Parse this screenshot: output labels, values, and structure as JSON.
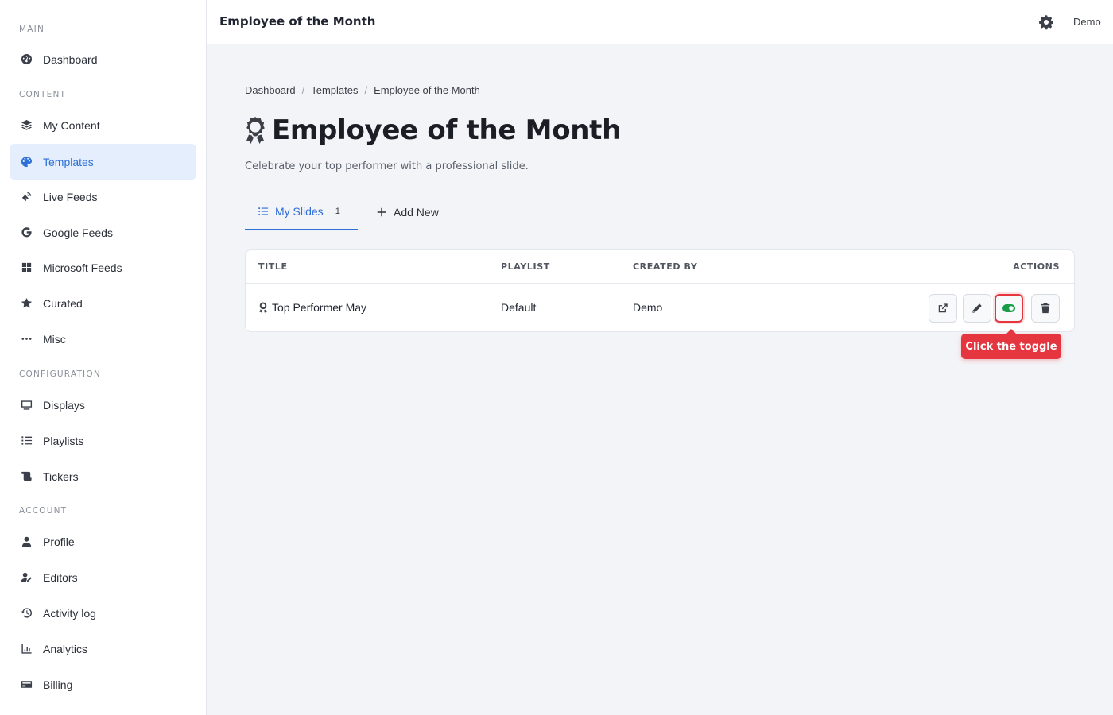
{
  "sidebar": {
    "sections": [
      {
        "label": "MAIN"
      },
      {
        "label": "CONTENT"
      },
      {
        "label": "CONFIGURATION"
      },
      {
        "label": "ACCOUNT"
      }
    ],
    "items": [
      {
        "label": "Dashboard",
        "icon": "gauge-icon"
      },
      {
        "label": "My Content",
        "icon": "layers-icon"
      },
      {
        "label": "Templates",
        "icon": "palette-icon"
      },
      {
        "label": "Live Feeds",
        "icon": "satellite-icon"
      },
      {
        "label": "Google Feeds",
        "icon": "google-icon"
      },
      {
        "label": "Microsoft Feeds",
        "icon": "windows-icon"
      },
      {
        "label": "Curated",
        "icon": "star-icon"
      },
      {
        "label": "Misc",
        "icon": "ellipsis-icon"
      },
      {
        "label": "Displays",
        "icon": "monitor-icon"
      },
      {
        "label": "Playlists",
        "icon": "list-icon"
      },
      {
        "label": "Tickers",
        "icon": "scroll-icon"
      },
      {
        "label": "Profile",
        "icon": "user-icon"
      },
      {
        "label": "Editors",
        "icon": "user-pen-icon"
      },
      {
        "label": "Activity log",
        "icon": "history-icon"
      },
      {
        "label": "Analytics",
        "icon": "chart-line-icon"
      },
      {
        "label": "Billing",
        "icon": "credit-card-icon"
      }
    ],
    "active_item": "Templates"
  },
  "topbar": {
    "title": "Employee of the Month",
    "user": "Demo"
  },
  "breadcrumb": [
    "Dashboard",
    "Templates",
    "Employee of the Month"
  ],
  "page": {
    "title": "Employee of the Month",
    "subtitle": "Celebrate your top performer with a professional slide."
  },
  "tabs": {
    "my_slides": "My Slides",
    "my_slides_count": "1",
    "add_new": "Add New"
  },
  "table": {
    "headers": [
      "TITLE",
      "PLAYLIST",
      "CREATED BY",
      "ACTIONS"
    ],
    "rows": [
      {
        "title": "Top Performer May",
        "playlist": "Default",
        "created_by": "Demo"
      }
    ]
  },
  "tooltip": "Click the toggle",
  "colors": {
    "accent": "#2f6fd8",
    "toggle_on": "#1a9c48",
    "highlight": "#e5363f"
  }
}
